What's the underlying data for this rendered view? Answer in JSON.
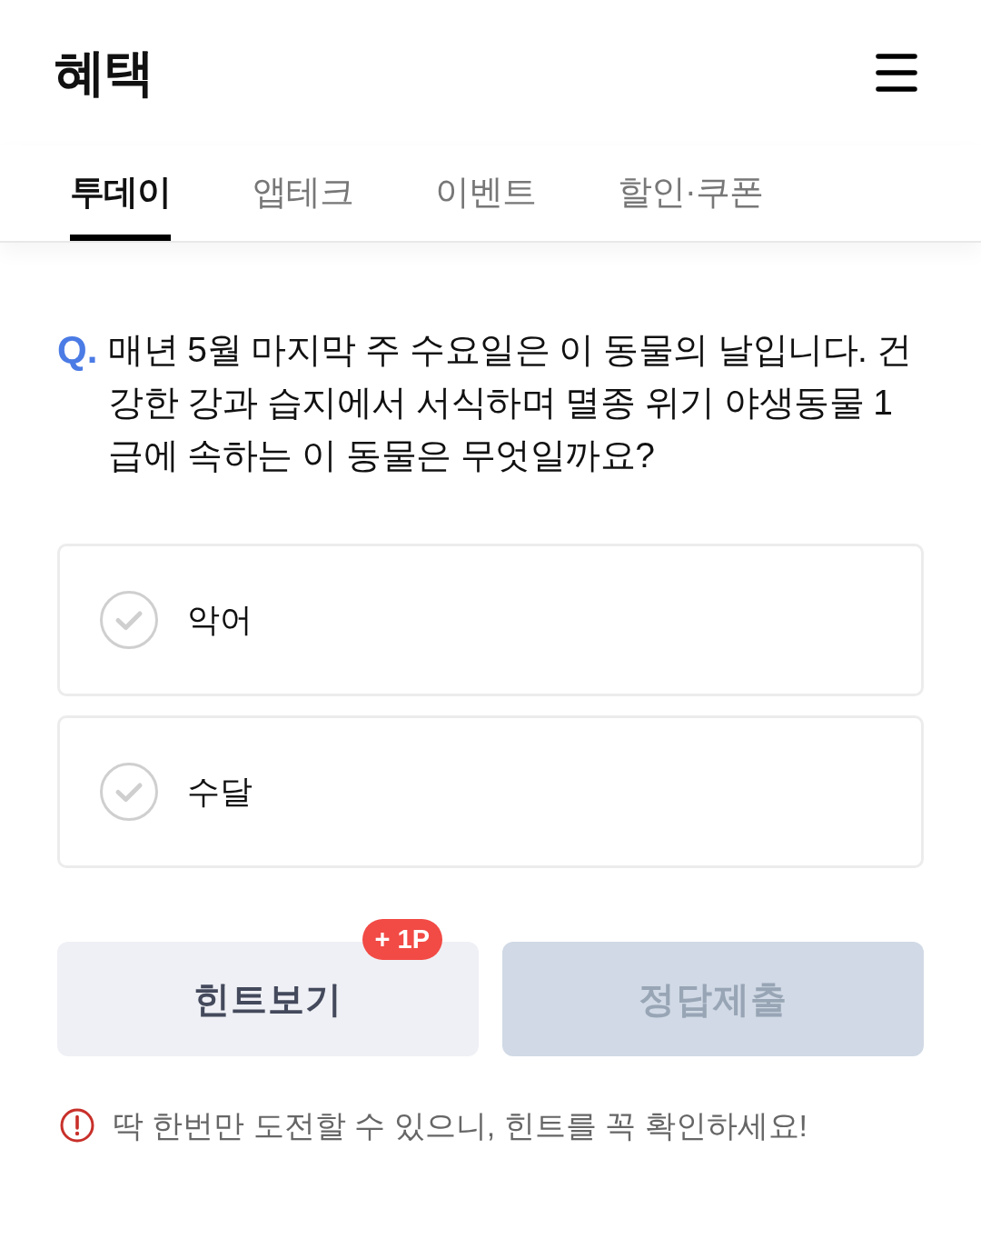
{
  "header": {
    "title": "혜택"
  },
  "tabs": [
    {
      "label": "투데이",
      "selected": true
    },
    {
      "label": "앱테크",
      "selected": false
    },
    {
      "label": "이벤트",
      "selected": false
    },
    {
      "label": "할인·쿠폰",
      "selected": false
    }
  ],
  "quiz": {
    "question_marker": "Q.",
    "question": "매년 5월 마지막 주 수요일은 이 동물의 날입니다. 건강한 강과 습지에서 서식하며 멸종 위기 야생동물 1급에 속하는 이 동물은 무엇일까요?",
    "options": [
      {
        "label": "악어",
        "selected": false
      },
      {
        "label": "수달",
        "selected": false
      }
    ]
  },
  "actions": [
    {
      "kind": "hint",
      "label": "힌트보기",
      "badge": "+ 1P",
      "disabled": false
    },
    {
      "kind": "submit",
      "label": "정답제출",
      "disabled": true
    }
  ],
  "notice": "딱 한번만 도전할 수 있으니, 힌트를 꼭 확인하세요!"
}
